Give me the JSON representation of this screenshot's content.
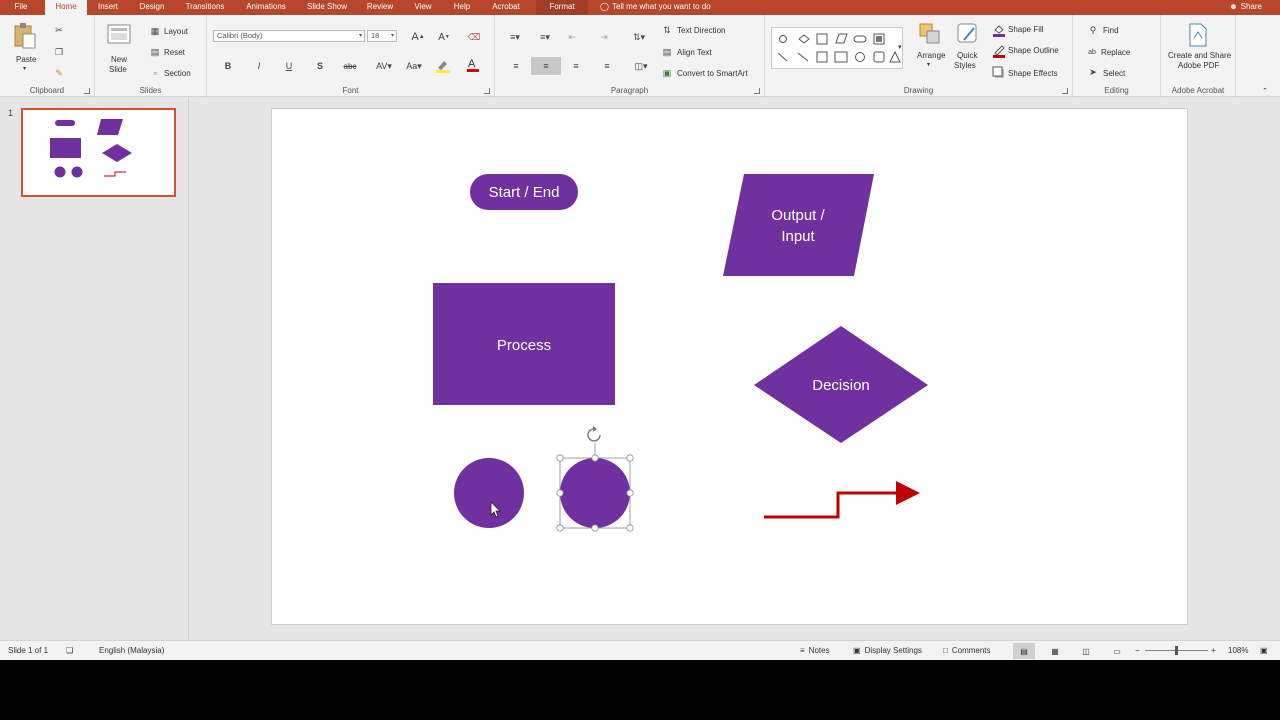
{
  "menu": {
    "tabs": [
      "File",
      "Home",
      "Insert",
      "Design",
      "Transitions",
      "Animations",
      "Slide Show",
      "Review",
      "View",
      "Help",
      "Acrobat",
      "Format"
    ],
    "active_tab": "Home",
    "tell_me": "Tell me what you want to do",
    "share": "Share"
  },
  "ribbon": {
    "clipboard": {
      "label": "Clipboard",
      "paste": "Paste"
    },
    "slides": {
      "label": "Slides",
      "new_slide": "New",
      "new_slide_2": "Slide",
      "layout": "Layout",
      "reset": "Reset",
      "section": "Section"
    },
    "font": {
      "label": "Font",
      "font_name": "Calibri (Body)",
      "font_size": "18"
    },
    "paragraph": {
      "label": "Paragraph",
      "text_direction": "Text Direction",
      "align_text": "Align Text",
      "convert_smartart": "Convert to SmartArt"
    },
    "drawing": {
      "label": "Drawing",
      "arrange": "Arrange",
      "quick_styles": "Quick",
      "quick_styles_2": "Styles",
      "shape_fill": "Shape Fill",
      "shape_outline": "Shape Outline",
      "shape_effects": "Shape Effects"
    },
    "editing": {
      "label": "Editing",
      "find": "Find",
      "replace": "Replace",
      "select": "Select"
    },
    "acrobat": {
      "label": "Adobe Acrobat",
      "create_share": "Create and Share",
      "adobe_pdf": "Adobe PDF"
    }
  },
  "thumbnail": {
    "number": "1"
  },
  "slide": {
    "shape_color": "#7030a0",
    "connector_color": "#c00000",
    "labels": {
      "start_end": "Start / End",
      "output_1": "Output /",
      "output_2": "Input",
      "process": "Process",
      "decision": "Decision"
    }
  },
  "status": {
    "slide_count": "Slide 1 of 1",
    "language": "English (Malaysia)",
    "notes": "Notes",
    "display_settings": "Display Settings",
    "comments": "Comments",
    "zoom": "108%"
  }
}
